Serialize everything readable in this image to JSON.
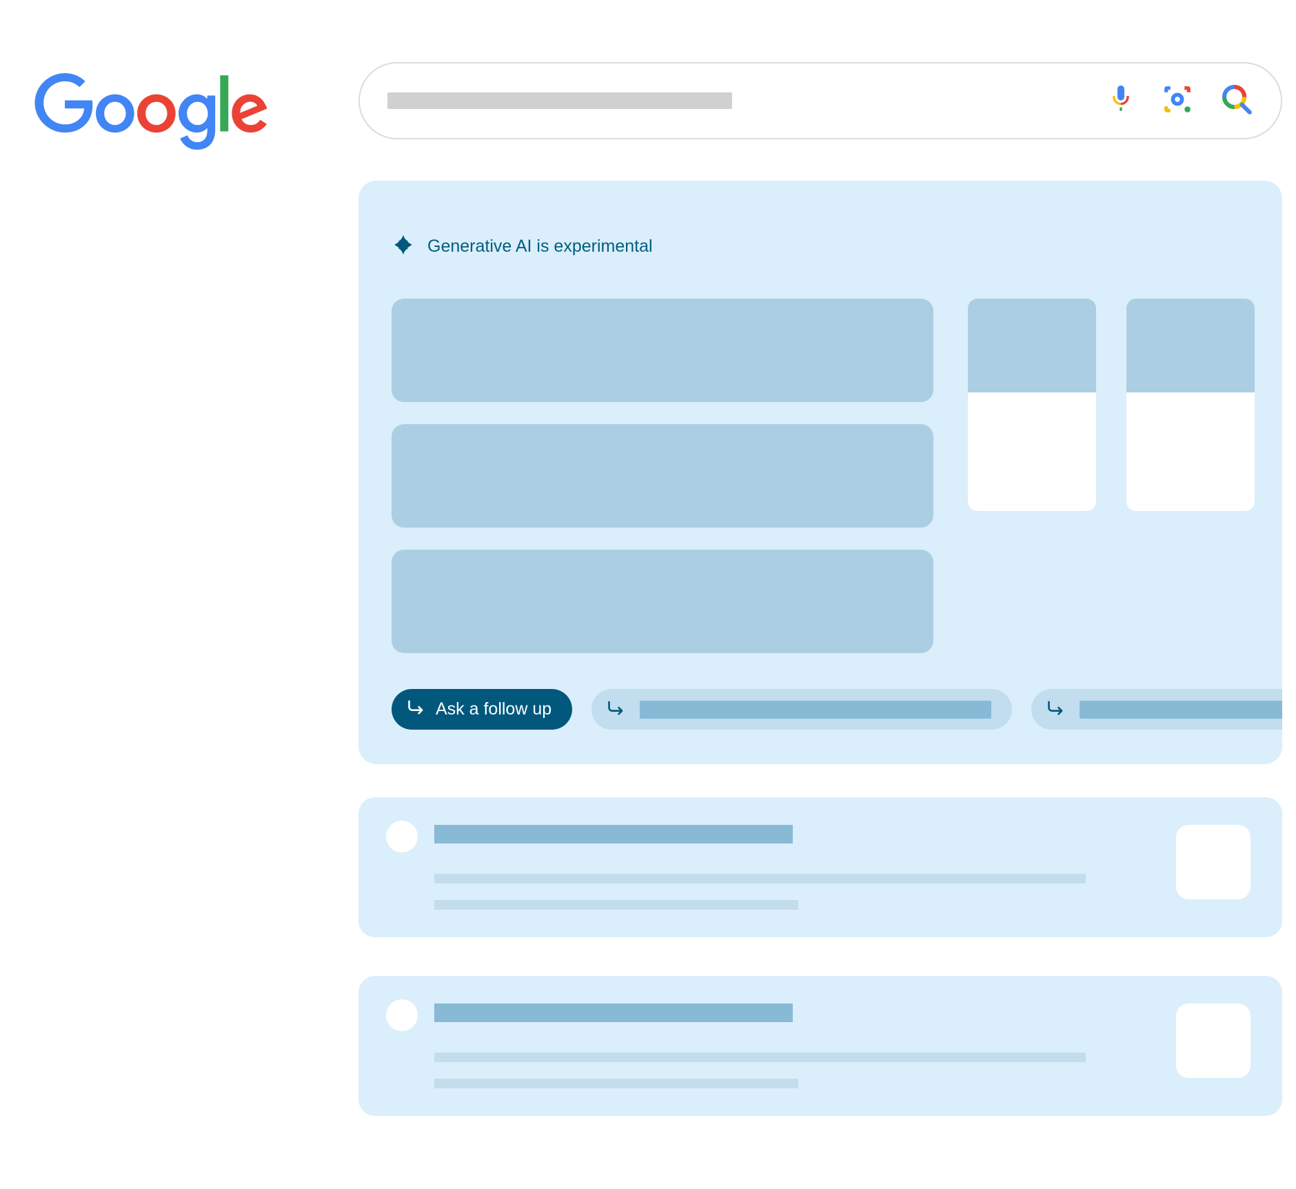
{
  "logo": "Google",
  "search": {
    "placeholder": ""
  },
  "ai": {
    "badge_label": "Generative AI is experimental",
    "followup_button": "Ask a follow up"
  },
  "icons": {
    "mic": "mic-icon",
    "lens": "lens-icon",
    "search": "search-icon",
    "sparkle": "sparkle-icon",
    "reply": "reply-arrow-icon"
  }
}
